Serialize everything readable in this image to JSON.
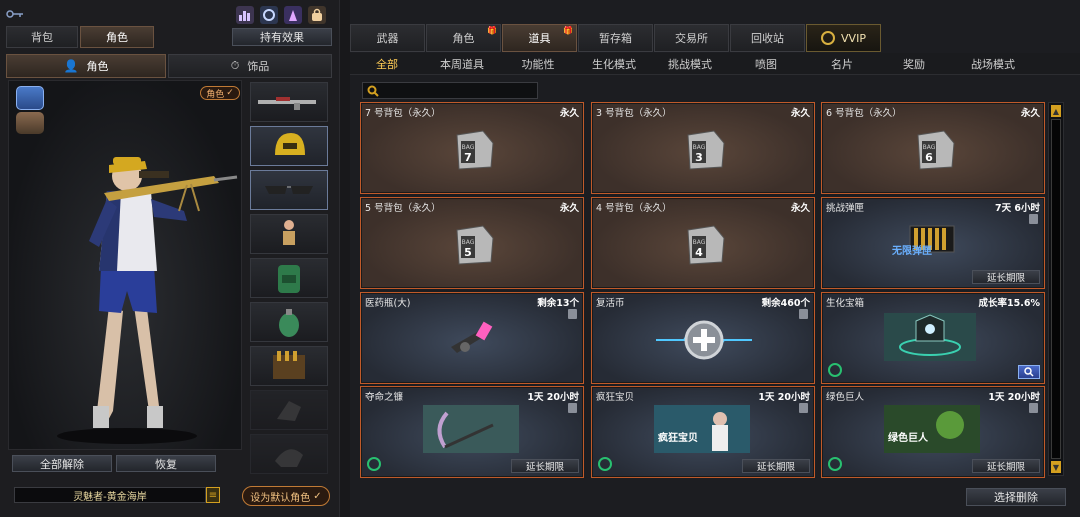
{
  "left": {
    "tabs": [
      {
        "label": "背包"
      },
      {
        "label": "角色"
      }
    ],
    "effects_button": "持有效果",
    "subtabs": [
      {
        "label": "角色"
      },
      {
        "label": "饰品"
      }
    ],
    "role_badge": "角色",
    "buttons": {
      "unequip_all": "全部解除",
      "restore": "恢复"
    },
    "character_name": "灵魅者-黄金海岸",
    "set_default": "设为默认角色"
  },
  "right": {
    "main_tabs": [
      {
        "label": "武器",
        "badge": false
      },
      {
        "label": "角色",
        "badge": true
      },
      {
        "label": "道具",
        "badge": true
      },
      {
        "label": "暂存箱",
        "badge": false
      },
      {
        "label": "交易所",
        "badge": false
      },
      {
        "label": "回收站",
        "badge": false
      },
      {
        "label": "VVIP",
        "badge": false
      }
    ],
    "sub_tabs": [
      {
        "label": "全部"
      },
      {
        "label": "本周道具"
      },
      {
        "label": "功能性"
      },
      {
        "label": "生化模式"
      },
      {
        "label": "挑战模式"
      },
      {
        "label": "喷图"
      },
      {
        "label": "名片"
      },
      {
        "label": "奖励"
      },
      {
        "label": "战场模式"
      }
    ],
    "items": [
      {
        "name": "7 号背包（永久）",
        "status": "永久",
        "bag_no": "7",
        "kind": "bag"
      },
      {
        "name": "3 号背包（永久）",
        "status": "永久",
        "bag_no": "3",
        "kind": "bag"
      },
      {
        "name": "6 号背包（永久）",
        "status": "永久",
        "bag_no": "6",
        "kind": "bag"
      },
      {
        "name": "5 号背包（永久）",
        "status": "永久",
        "bag_no": "5",
        "kind": "bag"
      },
      {
        "name": "4 号背包（永久）",
        "status": "永久",
        "bag_no": "4",
        "kind": "bag"
      },
      {
        "name": "挑战弹匣",
        "status": "7天 6小时",
        "kind": "ammo",
        "action": "延长期限",
        "art_text": "无限弹匣"
      },
      {
        "name": "医药瓶(大)",
        "status": "剩余13个",
        "kind": "potion"
      },
      {
        "name": "复活币",
        "status": "剩余460个",
        "kind": "revive"
      },
      {
        "name": "生化宝箱",
        "status": "成长率15.6%",
        "kind": "chest"
      },
      {
        "name": "夺命之镰",
        "status": "1天 20小时",
        "kind": "scythe",
        "action": "延长期限"
      },
      {
        "name": "疯狂宝贝",
        "status": "1天 20小时",
        "kind": "baby",
        "action": "延长期限",
        "art_text": "疯狂宝贝"
      },
      {
        "name": "绿色巨人",
        "status": "1天 20小时",
        "kind": "giant",
        "action": "延长期限",
        "art_text": "绿色巨人"
      }
    ],
    "bag_label": "BAG",
    "delete_button": "选择删除"
  },
  "colors": {
    "accent": "#ffcc55",
    "card_border": "#c05a2a",
    "bio_green": "#28c070",
    "badge_orange": "#c07a35"
  }
}
